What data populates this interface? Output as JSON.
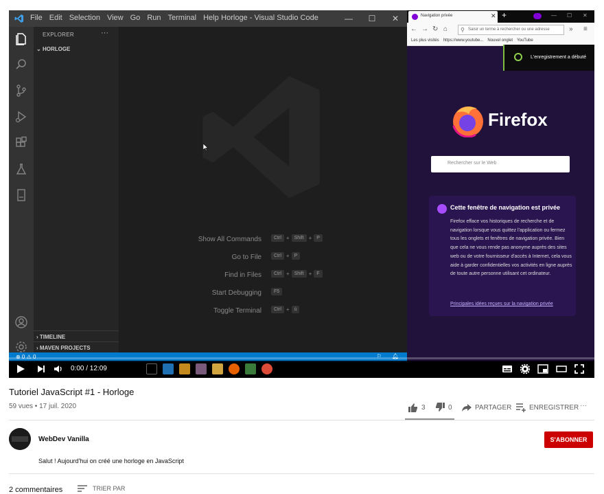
{
  "vscode": {
    "menu": [
      "File",
      "Edit",
      "Selection",
      "View",
      "Go",
      "Run",
      "Terminal",
      "Help"
    ],
    "title": "Horloge - Visual Studio Code",
    "explorer_title": "EXPLORER",
    "folder": "HORLOGE",
    "sections": [
      "TIMELINE",
      "MAVEN PROJECTS"
    ],
    "status_left": "⊗ 0 ⚠ 0",
    "commands": [
      {
        "label": "Show All Commands",
        "keys": [
          "Ctrl",
          "Shift",
          "P"
        ]
      },
      {
        "label": "Go to File",
        "keys": [
          "Ctrl",
          "P"
        ]
      },
      {
        "label": "Find in Files",
        "keys": [
          "Ctrl",
          "Shift",
          "F"
        ]
      },
      {
        "label": "Start Debugging",
        "keys": [
          "F5"
        ]
      },
      {
        "label": "Toggle Terminal",
        "keys": [
          "Ctrl",
          "ù"
        ]
      }
    ]
  },
  "firefox": {
    "tab_label": "Navigation privée",
    "url_placeholder": "Saisir un terme à rechercher ou une adresse",
    "bookmarks": [
      "Les plus visités",
      "https://www.youtube...",
      "Nouvel onglet",
      "YouTube"
    ],
    "recording_text": "L'enregistrement a débuté",
    "logo_text": "Firefox",
    "search_placeholder": "Rechercher sur le Web",
    "card_title": "Cette fenêtre de navigation est privée",
    "card_body": "Firefox efface vos historiques de recherche et de navigation lorsque vous quittez l'application ou fermez tous les onglets et fenêtres de navigation privée. Bien que cela ne vous rende pas anonyme auprès des sites web ou de votre fournisseur d'accès à Internet, cela vous aide à garder confidentielles vos activités en ligne auprès de toute autre personne utilisant cet ordinateur.",
    "card_link": "Principales idées reçues sur la navigation privée"
  },
  "player": {
    "time": "0:00 / 12:09",
    "progress": 0
  },
  "video": {
    "title": "Tutoriel JavaScript #1 - Horloge",
    "meta": "59 vues • 17 juil. 2020",
    "likes": "3",
    "dislikes": "0",
    "share_label": "PARTAGER",
    "save_label": "ENREGISTRER"
  },
  "channel": {
    "name": "WebDev Vanilla",
    "subscribe_label": "S'ABONNER",
    "description": "Salut ! Aujourd'hui on créé une horloge en JavaScript"
  },
  "comments": {
    "count_label": "2 commentaires",
    "sort_label": "TRIER PAR"
  },
  "colors": {
    "subscribe": "#cc0000",
    "vscode_status": "#007acc",
    "firefox_bg": "#20123a"
  }
}
